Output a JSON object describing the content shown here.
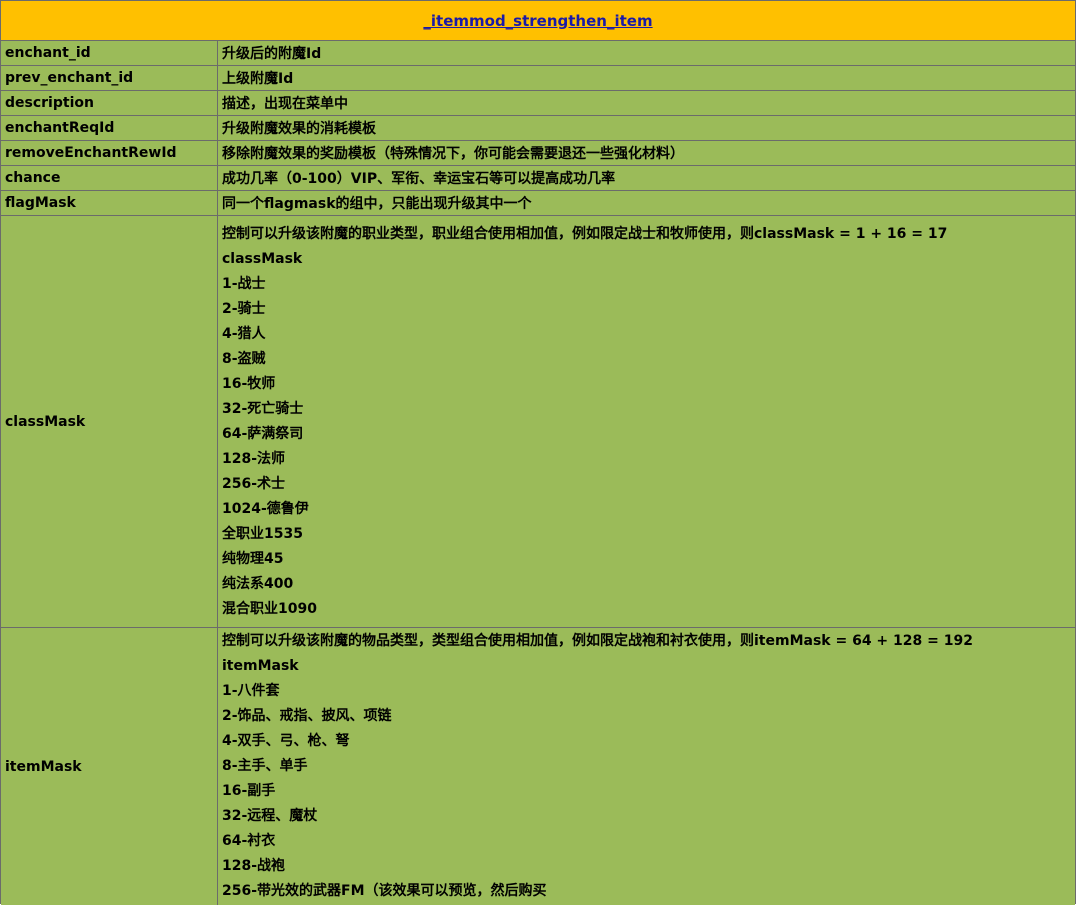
{
  "title": "_itemmod_strengthen_item",
  "rows": [
    {
      "key": "enchant_id",
      "value": "升级后的附魔Id"
    },
    {
      "key": "prev_enchant_id",
      "value": "上级附魔Id"
    },
    {
      "key": "description",
      "value": "描述，出现在菜单中"
    },
    {
      "key": "enchantReqId",
      "value": "升级附魔效果的消耗模板"
    },
    {
      "key": "removeEnchantRewId",
      "value": "移除附魔效果的奖励模板（特殊情况下，你可能会需要退还一些强化材料）"
    },
    {
      "key": "chance",
      "value": "成功几率（0-100）VIP、军衔、幸运宝石等可以提高成功几率"
    },
    {
      "key": "flagMask",
      "value": "同一个flagmask的组中，只能出现升级其中一个"
    }
  ],
  "classMask": {
    "key": "classMask",
    "lines": [
      "控制可以升级该附魔的职业类型，职业组合使用相加值，例如限定战士和牧师使用，则classMask = 1 + 16 = 17",
      "classMask",
      "1-战士",
      "2-骑士",
      "4-猎人",
      "8-盗贼",
      "16-牧师",
      "32-死亡骑士",
      "64-萨满祭司",
      "128-法师",
      "256-术士",
      "1024-德鲁伊",
      "全职业1535",
      "纯物理45",
      "纯法系400",
      "混合职业1090"
    ]
  },
  "itemMask": {
    "key": "itemMask",
    "lines": [
      "控制可以升级该附魔的物品类型，类型组合使用相加值，例如限定战袍和衬衣使用，则itemMask = 64 + 128 = 192",
      "itemMask",
      "1-八件套",
      "2-饰品、戒指、披风、项链",
      "4-双手、弓、枪、弩",
      "8-主手、单手",
      "16-副手",
      "32-远程、魔杖",
      "64-衬衣",
      "128-战袍",
      "256-带光效的武器FM（该效果可以预览，然后购买"
    ]
  }
}
